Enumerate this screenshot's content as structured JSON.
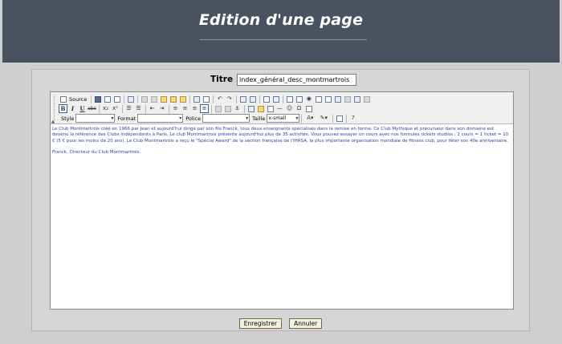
{
  "header": {
    "title": "Edition d'une page"
  },
  "form": {
    "title_label": "Titre :",
    "title_value": "index_général_desc_montmartrois"
  },
  "toolbar": {
    "source_label": "Source",
    "style_label": "Style",
    "format_label": "Format",
    "font_label": "Police",
    "size_label": "Taille",
    "size_value": "x-small",
    "bold": "B",
    "italic": "I",
    "underline": "U",
    "strike": "abc",
    "subscript": "x₂",
    "superscript": "x²",
    "icons": [
      "source-icon",
      "save-icon",
      "new-page-icon",
      "preview-icon",
      "templates-icon",
      "cut-icon",
      "copy-icon",
      "paste-icon",
      "paste-text-icon",
      "paste-word-icon",
      "print-icon",
      "spellcheck-icon",
      "undo-icon",
      "redo-icon",
      "find-icon",
      "replace-icon",
      "select-all-icon",
      "remove-format-icon",
      "form-icon",
      "checkbox-icon",
      "radio-icon",
      "textfield-icon",
      "textarea-icon",
      "select-icon",
      "button-icon",
      "image-button-icon",
      "hidden-field-icon",
      "numbered-list-icon",
      "bulleted-list-icon",
      "outdent-icon",
      "indent-icon",
      "align-left-icon",
      "align-center-icon",
      "align-right-icon",
      "justify-icon",
      "link-icon",
      "unlink-icon",
      "anchor-icon",
      "image-icon",
      "flash-icon",
      "table-icon",
      "rule-icon",
      "smiley-icon",
      "special-char-icon",
      "page-break-icon",
      "text-color-icon",
      "bg-color-icon",
      "maximize-icon",
      "about-icon"
    ]
  },
  "content": {
    "paragraph1": "Le Club Montmartrois créé en 1966 par Jean et aujourd'hui dirigé par son fils Franck, tous deux enseignants spécialisés dans la remise en forme. Ce Club Mythique et précurseur dans son domaine est devenu la référence des Clubs indépendants à Paris. Le club Montmartrois présente aujourd'hui plus de 35 activités. Vous pouvez essayer un cours avec nos formules tickets studios : 1 cours = 1 ticket = 10 € (5 € pour les moins de 20 ans). Le Club Montmartrois a reçu le \"Spécial Award\" de la section française de l'IHRSA, la plus importante organisation mondiale de fitness club, pour fêter son 40e anniversaire.",
    "paragraph2": "Franck, Directeur du Club Montmartrois."
  },
  "buttons": {
    "save": "Enregistrer",
    "cancel": "Annuler"
  }
}
